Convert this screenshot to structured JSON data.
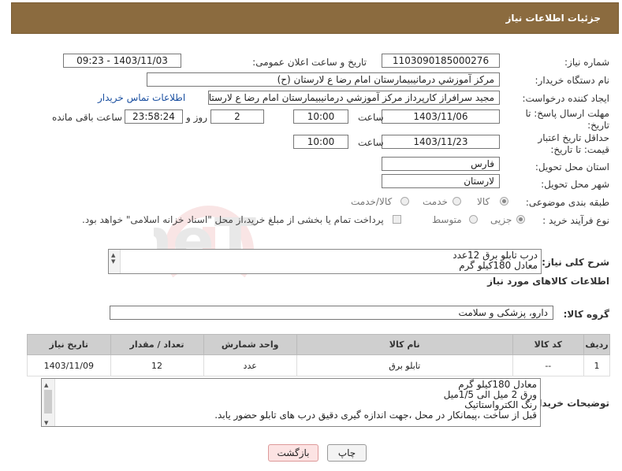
{
  "header": {
    "title": "جزئیات اطلاعات نیاز"
  },
  "form": {
    "need_number": {
      "label": "شماره نیاز:",
      "value": "1103090185000276"
    },
    "announce_datetime": {
      "label": "تاریخ و ساعت اعلان عمومی:",
      "value": "1403/11/03 - 09:23"
    },
    "buyer_org": {
      "label": "نام دستگاه خریدار:",
      "value": "مرکز آموزشي درمانيبيمارستان امام رضا  ع  لارستان (ح)"
    },
    "requester": {
      "label": "ایجاد کننده درخواست:",
      "value": "مجید سرافراز کارپرداز  مرکز آموزشي درمانيبيمارستان امام رضا  ع  لارستان (ح)",
      "contact_link": "اطلاعات تماس خریدار"
    },
    "deadline": {
      "label": "مهلت ارسال پاسخ: تا تاریخ:",
      "date": "1403/11/06",
      "time_label": "ساعت",
      "time": "10:00",
      "days": "2",
      "days_label": "روز و",
      "remaining": "23:58:24",
      "remaining_label": "ساعت باقی مانده"
    },
    "price_validity": {
      "label": "حداقل تاریخ اعتبار قیمت: تا تاریخ:",
      "date": "1403/11/23",
      "time_label": "ساعت",
      "time": "10:00"
    },
    "province": {
      "label": "استان محل تحویل:",
      "value": "فارس"
    },
    "city": {
      "label": "شهر محل تحویل:",
      "value": "لارستان"
    },
    "category": {
      "label": "طبقه بندی موضوعی:",
      "options": [
        "کالا",
        "خدمت",
        "کالا/خدمت"
      ]
    },
    "purchase_type": {
      "label": "نوع فرآیند خرید :",
      "options": [
        "جزیی",
        "متوسط"
      ],
      "note": "پرداخت تمام یا بخشی از مبلغ خرید،از محل \"اسناد خزانه اسلامی\" خواهد بود."
    }
  },
  "summary": {
    "label": "شرح کلی نیاز:",
    "lines": [
      "درب تابلو برق  12عدد",
      "معادل 180کیلو گرم"
    ]
  },
  "goods_section": {
    "title": "اطلاعات کالاهای مورد نیاز"
  },
  "goods_group": {
    "label": "گروه کالا:",
    "value": "دارو، پزشکی و سلامت"
  },
  "table": {
    "headers": [
      "ردیف",
      "کد کالا",
      "نام کالا",
      "واحد شمارش",
      "تعداد / مقدار",
      "تاریخ نیاز"
    ],
    "rows": [
      [
        "1",
        "--",
        "تابلو برق",
        "عدد",
        "12",
        "1403/11/09"
      ]
    ]
  },
  "buyer_notes": {
    "label": "توضیحات خریدار:",
    "lines": [
      "معادل 180کیلو گرم",
      "ورق 2 میل الی 1/5میل",
      "رنگ الکترواستاتیک",
      "قبل از ساخت ،پیمانکار در محل ،جهت اندازه گیری دقیق درب های تابلو حضور یابد."
    ]
  },
  "buttons": {
    "print": "چاپ",
    "back": "بازگشت"
  },
  "watermark": {
    "text": "AriaTender.neT"
  },
  "colors": {
    "header": "#8b6b3f",
    "link": "#1a4fa0",
    "back_button": "#fce3e3"
  }
}
